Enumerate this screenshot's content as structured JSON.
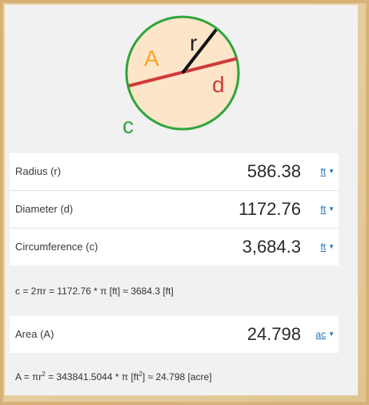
{
  "diagram": {
    "label_a": "A",
    "label_r": "r",
    "label_d": "d",
    "label_c": "c"
  },
  "rows": [
    {
      "label": "Radius (r)",
      "value": "586.38",
      "unit": "ft"
    },
    {
      "label": "Diameter (d)",
      "value": "1172.76",
      "unit": "ft"
    },
    {
      "label": "Circumference (c)",
      "value": "3,684.3",
      "unit": "ft"
    }
  ],
  "circumference_formula": "c = 2πr = 1172.76 * π [ft] ≈ 3684.3 [ft]",
  "area": {
    "label": "Area (A)",
    "value": "24.798",
    "unit": "ac"
  },
  "area_formula": {
    "prefix": "A = πr",
    "exp": "2",
    "middle": " = 343841.5044 * π [ft",
    "exp2": "2",
    "suffix": "] ≈ 24.798 [acre]"
  },
  "colors": {
    "circle_stroke": "#2ea53c",
    "circle_fill": "#fde5c9",
    "diameter_line": "#d03b3b",
    "radius_line": "#111111",
    "label_a": "#f5a623",
    "label_d": "#d03b3b",
    "label_c": "#2ea53c",
    "unit_link": "#1e73b8"
  }
}
